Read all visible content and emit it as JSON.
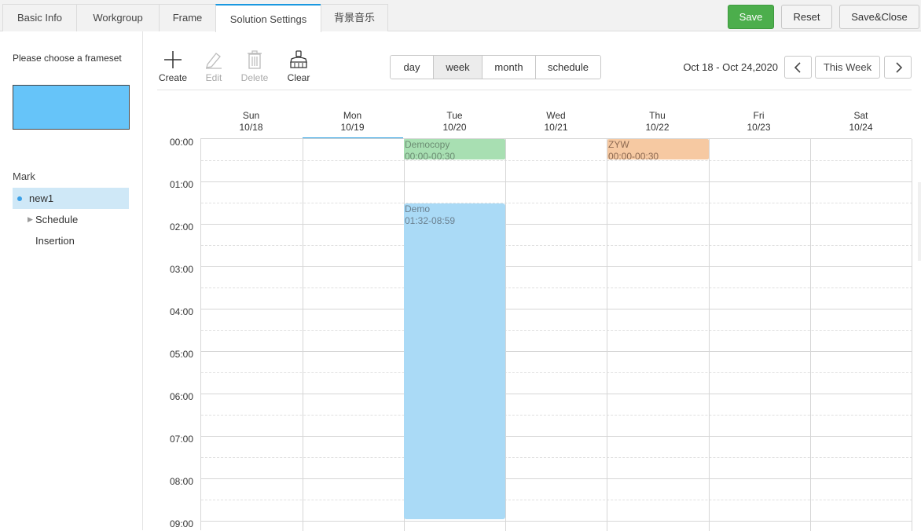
{
  "tabs": [
    {
      "label": "Basic Info"
    },
    {
      "label": "Workgroup"
    },
    {
      "label": "Frame"
    },
    {
      "label": "Solution Settings"
    },
    {
      "label": "背景音乐"
    }
  ],
  "header_buttons": {
    "save": "Save",
    "reset": "Reset",
    "save_close": "Save&Close"
  },
  "left_panel": {
    "choose_label": "Please choose a frameset",
    "frameset_color": "#66c4f9",
    "mark_label": "Mark",
    "tree": [
      {
        "label": "new1"
      },
      {
        "label": "Schedule"
      },
      {
        "label": "Insertion"
      }
    ]
  },
  "toolbar": {
    "create": "Create",
    "edit": "Edit",
    "delete": "Delete",
    "clear": "Clear"
  },
  "view_modes": {
    "day": "day",
    "week": "week",
    "month": "month",
    "schedule": "schedule",
    "selected": "week"
  },
  "date_range": "Oct 18 - Oct 24,2020",
  "nav": {
    "prev_icon": "chevron-left-icon",
    "this_week": "This Week",
    "next_icon": "chevron-right-icon"
  },
  "days": [
    {
      "name": "Sun",
      "date": "10/18"
    },
    {
      "name": "Mon",
      "date": "10/19"
    },
    {
      "name": "Tue",
      "date": "10/20"
    },
    {
      "name": "Wed",
      "date": "10/21"
    },
    {
      "name": "Thu",
      "date": "10/22"
    },
    {
      "name": "Fri",
      "date": "10/23"
    },
    {
      "name": "Sat",
      "date": "10/24"
    }
  ],
  "today": "Mon",
  "hours": [
    "00:00",
    "01:00",
    "02:00",
    "03:00",
    "04:00",
    "05:00",
    "06:00",
    "07:00",
    "08:00",
    "09:00"
  ],
  "events": [
    {
      "title": "Democopy",
      "time": "00:00-00:30",
      "day": "Tue",
      "color": "#a8dfb2"
    },
    {
      "title": "ZYW",
      "time": "00:00-00:30",
      "day": "Thu",
      "color": "#f6c9a2"
    },
    {
      "title": "Demo",
      "time": "01:32-08:59",
      "day": "Tue",
      "color": "#aadaf6"
    }
  ]
}
